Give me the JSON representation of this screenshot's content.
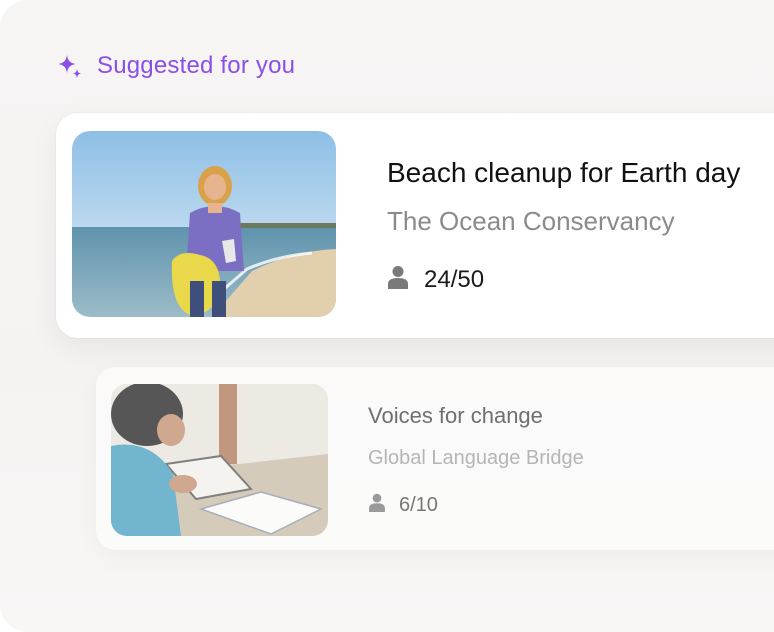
{
  "header": {
    "icon": "sparkle-icon",
    "label": "Suggested for you",
    "accent_color": "#8a4fe6"
  },
  "cards": [
    {
      "image": "beach-cleanup-photo",
      "title": "Beach cleanup for Earth day",
      "organization": "The Ocean Conservancy",
      "participants_icon": "person-icon",
      "participants": "24/50"
    },
    {
      "image": "reading-books-photo",
      "title": "Voices for change",
      "organization": "Global Language Bridge",
      "participants_icon": "person-icon",
      "participants": "6/10"
    }
  ]
}
